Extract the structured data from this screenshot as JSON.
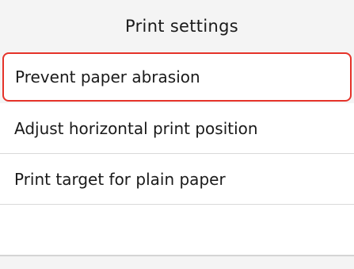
{
  "screen": {
    "title": "Print settings",
    "menu": [
      {
        "label": "Prevent paper abrasion",
        "selected": true
      },
      {
        "label": "Adjust horizontal print position",
        "selected": false
      },
      {
        "label": "Print target for plain paper",
        "selected": false
      },
      {
        "label": "",
        "selected": false
      }
    ],
    "colors": {
      "selection_border": "#e5332a",
      "background": "#f4f4f4",
      "item_background": "#ffffff",
      "divider": "#d9d9d9"
    }
  }
}
